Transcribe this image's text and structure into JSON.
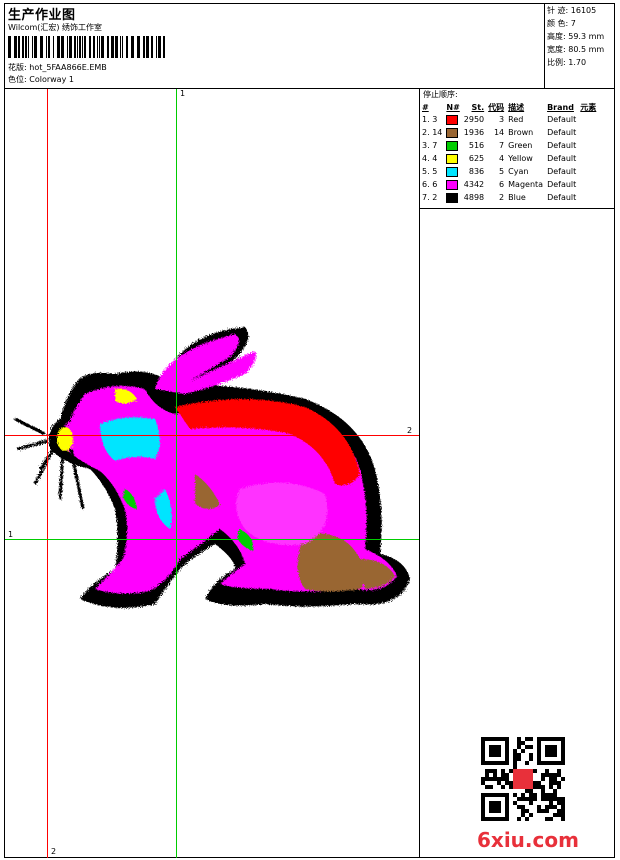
{
  "header": {
    "title": "生产作业图",
    "company": "Wilcom(汇宏) 绣饰工作室",
    "file_label": "花版:",
    "file_name": "hot_5FAA866E.EMB",
    "colorway_label": "色位:",
    "colorway_name": "Colorway 1"
  },
  "stats": {
    "stitches": "针 迹: 16105",
    "colors": "颜 色: 7",
    "height": "高度: 59.3 mm",
    "width": "宽度: 80.5 mm",
    "scale": "比例: 1.70"
  },
  "stop_sequence": {
    "title": "停止顺序:",
    "headers": [
      "#",
      "N#",
      "St.",
      "代码",
      "描述",
      "Brand",
      "元素"
    ],
    "rows": [
      {
        "idx": "1.",
        "n": "3",
        "st": "2950",
        "code": "3",
        "desc": "Red",
        "brand": "Default",
        "color": "#ff0000"
      },
      {
        "idx": "2.",
        "n": "14",
        "st": "1936",
        "code": "14",
        "desc": "Brown",
        "brand": "Default",
        "color": "#996633"
      },
      {
        "idx": "3.",
        "n": "7",
        "st": "516",
        "code": "7",
        "desc": "Green",
        "brand": "Default",
        "color": "#00cc00"
      },
      {
        "idx": "4.",
        "n": "4",
        "st": "625",
        "code": "4",
        "desc": "Yellow",
        "brand": "Default",
        "color": "#ffff00"
      },
      {
        "idx": "5.",
        "n": "5",
        "st": "836",
        "code": "5",
        "desc": "Cyan",
        "brand": "Default",
        "color": "#00e5ff"
      },
      {
        "idx": "6.",
        "n": "6",
        "st": "4342",
        "code": "6",
        "desc": "Magenta",
        "brand": "Default",
        "color": "#ff00ff"
      },
      {
        "idx": "7.",
        "n": "2",
        "st": "4898",
        "code": "2",
        "desc": "Blue",
        "brand": "Default",
        "color": "#000000"
      }
    ]
  },
  "guides": {
    "v1_label": "1",
    "v2_label": "2",
    "h1_label": "1",
    "h2_label": "2"
  },
  "watermark": "6xiu.com"
}
